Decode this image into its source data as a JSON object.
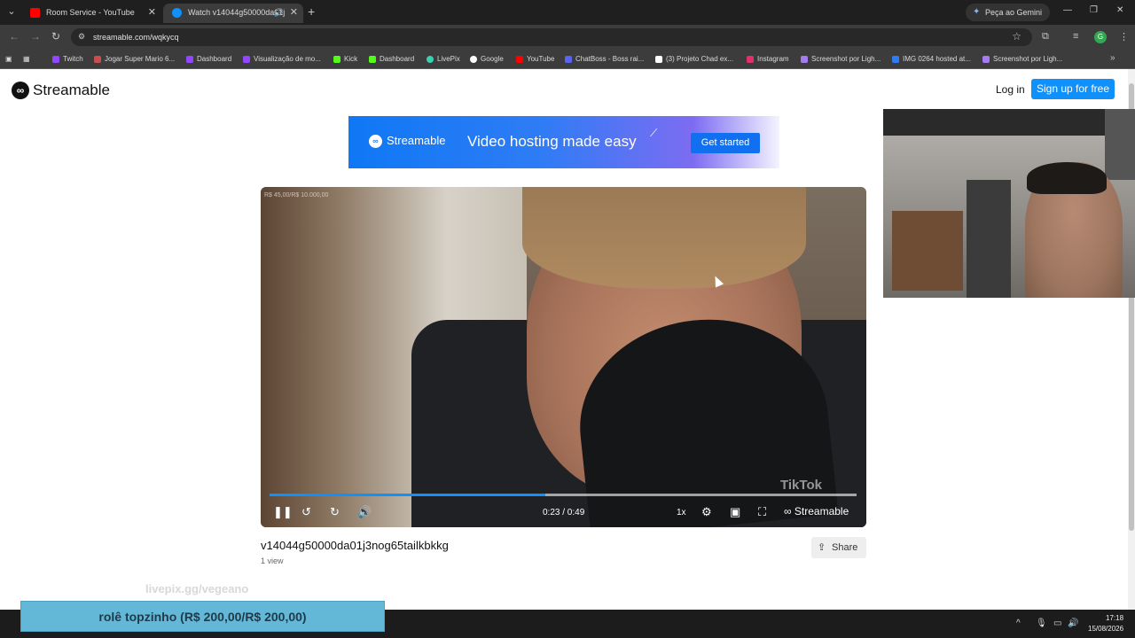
{
  "browser": {
    "tabs": [
      {
        "title": "Room Service - YouTube",
        "favicon_color": "#ff0000"
      },
      {
        "title": "Watch v14044g50000da01j",
        "favicon_color": "#0f90fa"
      }
    ],
    "gemini_label": "Peça ao Gemini",
    "url": "streamable.com/wqkycq",
    "profile_initial": "G",
    "bookmarks": [
      {
        "label": "Twitch",
        "color": "#9146ff"
      },
      {
        "label": "Jogar Super Mario 6...",
        "color": "#c94f4f"
      },
      {
        "label": "Dashboard",
        "color": "#9146ff"
      },
      {
        "label": "Visualização de mo...",
        "color": "#9146ff"
      },
      {
        "label": "Kick",
        "color": "#53fc18"
      },
      {
        "label": "Dashboard",
        "color": "#53fc18"
      },
      {
        "label": "LivePix",
        "color": "#3ad1b0"
      },
      {
        "label": "Google",
        "color": "#ffffff"
      },
      {
        "label": "YouTube",
        "color": "#ff0000"
      },
      {
        "label": "ChatBoss - Boss rai...",
        "color": "#5865f2"
      },
      {
        "label": "(3) Projeto Chad ex...",
        "color": "#ffffff"
      },
      {
        "label": "Instagram",
        "color": "#e1306c"
      },
      {
        "label": "Screenshot por Ligh...",
        "color": "#a37cf0"
      },
      {
        "label": "IMG 0264 hosted at...",
        "color": "#2f7cf5"
      },
      {
        "label": "Screenshot por Ligh...",
        "color": "#a37cf0"
      }
    ]
  },
  "site": {
    "brand": "Streamable",
    "login": "Log in",
    "signup": "Sign up for free",
    "banner": {
      "brand": "Streamable",
      "tagline": "Video hosting made easy",
      "cta": "Get started"
    }
  },
  "player": {
    "overlay_text": "R$ 45,00/R$ 10.000,00",
    "watermark": "TikTok",
    "current_time": "0:23",
    "duration": "0:49",
    "time_display": "0:23 / 0:49",
    "progress_fraction": 0.47,
    "speed": "1x",
    "brand": "Streamable"
  },
  "video": {
    "title": "v14044g50000da01j3nog65tailkbkkg",
    "views": "1 view",
    "share_label": "Share"
  },
  "stream_overlay": {
    "livepix_url": "livepix.gg/vegeano",
    "donation_text": "rolê topzinho (R$ 200,00/R$ 200,00)"
  },
  "taskbar": {
    "time": "17:18",
    "date": "15/08/2026"
  },
  "colors": {
    "accent": "#0f90fa",
    "donation_bg": "#62b8d6"
  }
}
